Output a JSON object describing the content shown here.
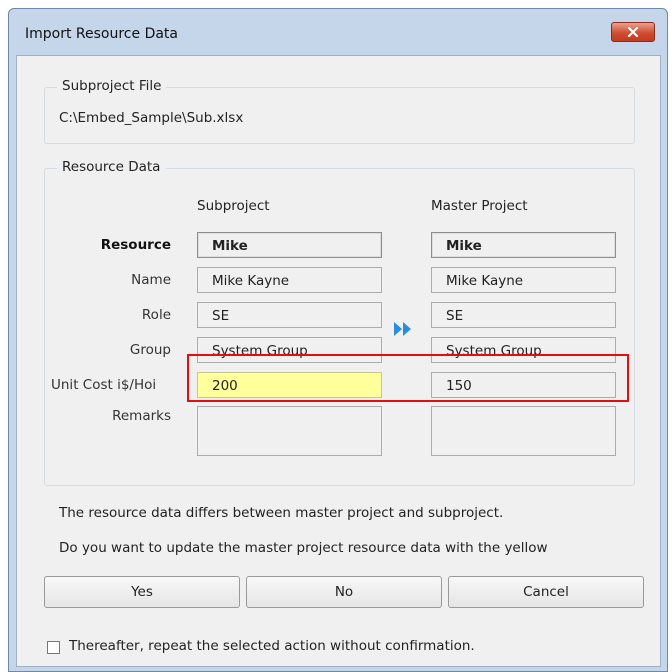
{
  "window": {
    "title": "Import Resource Data"
  },
  "subproject_file": {
    "legend": "Subproject File",
    "path": "C:\\Embed_Sample\\Sub.xlsx"
  },
  "resource_data": {
    "legend": "Resource Data",
    "col_subproject": "Subproject",
    "col_master": "Master Project",
    "rows": [
      {
        "label": "Resource",
        "sub": "Mike",
        "master": "Mike"
      },
      {
        "label": "Name",
        "sub": "Mike Kayne",
        "master": "Mike Kayne"
      },
      {
        "label": "Role",
        "sub": "SE",
        "master": "SE"
      },
      {
        "label": "Group",
        "sub": "System Group",
        "master": "System Group"
      },
      {
        "label": "Unit Cost  i$/Hoi",
        "sub": "200",
        "master": "150"
      },
      {
        "label": "Remarks",
        "sub": "",
        "master": ""
      }
    ],
    "arrow_icon": "double-chevron-right-icon",
    "highlight_color": "#e01010",
    "diff_color": "#ffff9b"
  },
  "message": {
    "line1": "The resource data differs between master project and subproject.",
    "line2": "Do you want to update the master project resource data with the yellow"
  },
  "buttons": {
    "yes": "Yes",
    "no": "No",
    "cancel": "Cancel"
  },
  "checkbox": {
    "label": "Thereafter, repeat the selected action without confirmation.",
    "checked": false
  }
}
